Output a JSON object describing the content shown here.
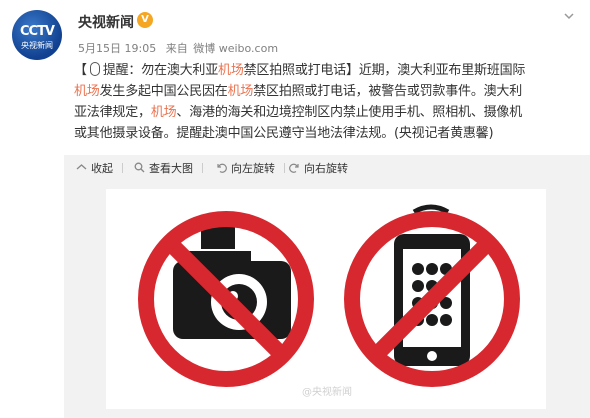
{
  "user": {
    "name": "央视新闻",
    "verified_icon": "verified-badge-icon",
    "avatar_logo": "CCTV",
    "avatar_subtitle": "央视新闻"
  },
  "meta": {
    "time": "5月15日 19:05",
    "source_label": "来自",
    "source": "微博 weibo.com"
  },
  "post": {
    "bracket_open": "【",
    "line1_a": "提醒：勿在澳大利亚",
    "line1_hl": "机场",
    "line1_b": "禁区拍照或打电话】近期，澳大利亚布里斯班国际",
    "line2_hl": "机场",
    "line2_a": "发生多起中国公民因在",
    "line2_hl2": "机场",
    "line2_b": "禁区拍照或打电话，被警告或罚款事件。澳大利",
    "line3_a": "亚法律规定，",
    "line3_hl": "机场",
    "line3_b": "、海港的海关和边境控制区内禁止使用手机、照相机、摄像机",
    "line4": "或其他摄录设备。提醒赴澳中国公民遵守当地法律法规。(央视记者黄惠馨)"
  },
  "toolbar": {
    "collapse": "收起",
    "view_large": "查看大图",
    "rotate_left": "向左旋转",
    "rotate_right": "向右旋转"
  },
  "image": {
    "watermark": "@央视新闻",
    "sign_color": "#d7282f"
  }
}
